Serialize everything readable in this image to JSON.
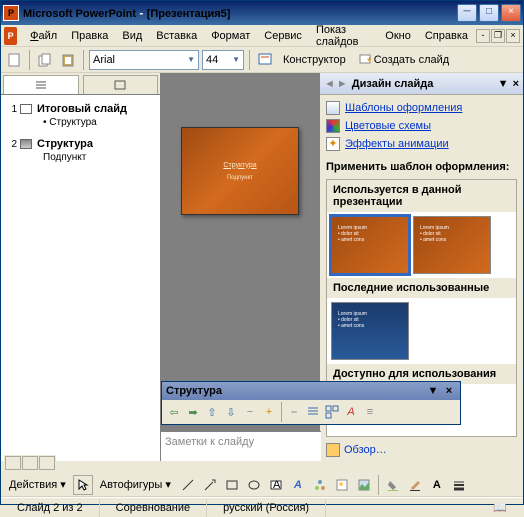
{
  "titlebar": {
    "app": "Microsoft PowerPoint",
    "doc": "[Презентация5]"
  },
  "menu": {
    "file": "Файл",
    "edit": "Правка",
    "view": "Вид",
    "insert": "Вставка",
    "format": "Формат",
    "service": "Сервис",
    "slideshow": "Показ слайдов",
    "window": "Окно",
    "help": "Справка"
  },
  "toolbar": {
    "font": "Arial",
    "size": "44",
    "designer": "Конструктор",
    "newslide": "Создать слайд"
  },
  "outline": {
    "items": [
      {
        "num": "1",
        "title": "Итоговый слайд",
        "subs": [
          "Структура"
        ]
      },
      {
        "num": "2",
        "title": "Структура",
        "subs": [
          "Подпункт"
        ]
      }
    ]
  },
  "slide": {
    "title": "Структура",
    "body": "Подпункт"
  },
  "struct": {
    "title": "Структура"
  },
  "notes": {
    "placeholder": "Заметки к слайду"
  },
  "design": {
    "title": "Дизайн слайда",
    "links": {
      "templates": "Шаблоны оформления",
      "colors": "Цветовые схемы",
      "effects": "Эффекты анимации"
    },
    "apply": "Применить шаблон оформления:",
    "used": "Используется в данной презентации",
    "recent": "Последние использованные",
    "avail": "Доступно для использования",
    "browse": "Обзор…"
  },
  "drawbar": {
    "actions": "Действия",
    "autoshapes": "Автофигуры"
  },
  "status": {
    "slide": "Слайд 2 из 2",
    "theme": "Соревнование",
    "lang": "русский (Россия)"
  }
}
